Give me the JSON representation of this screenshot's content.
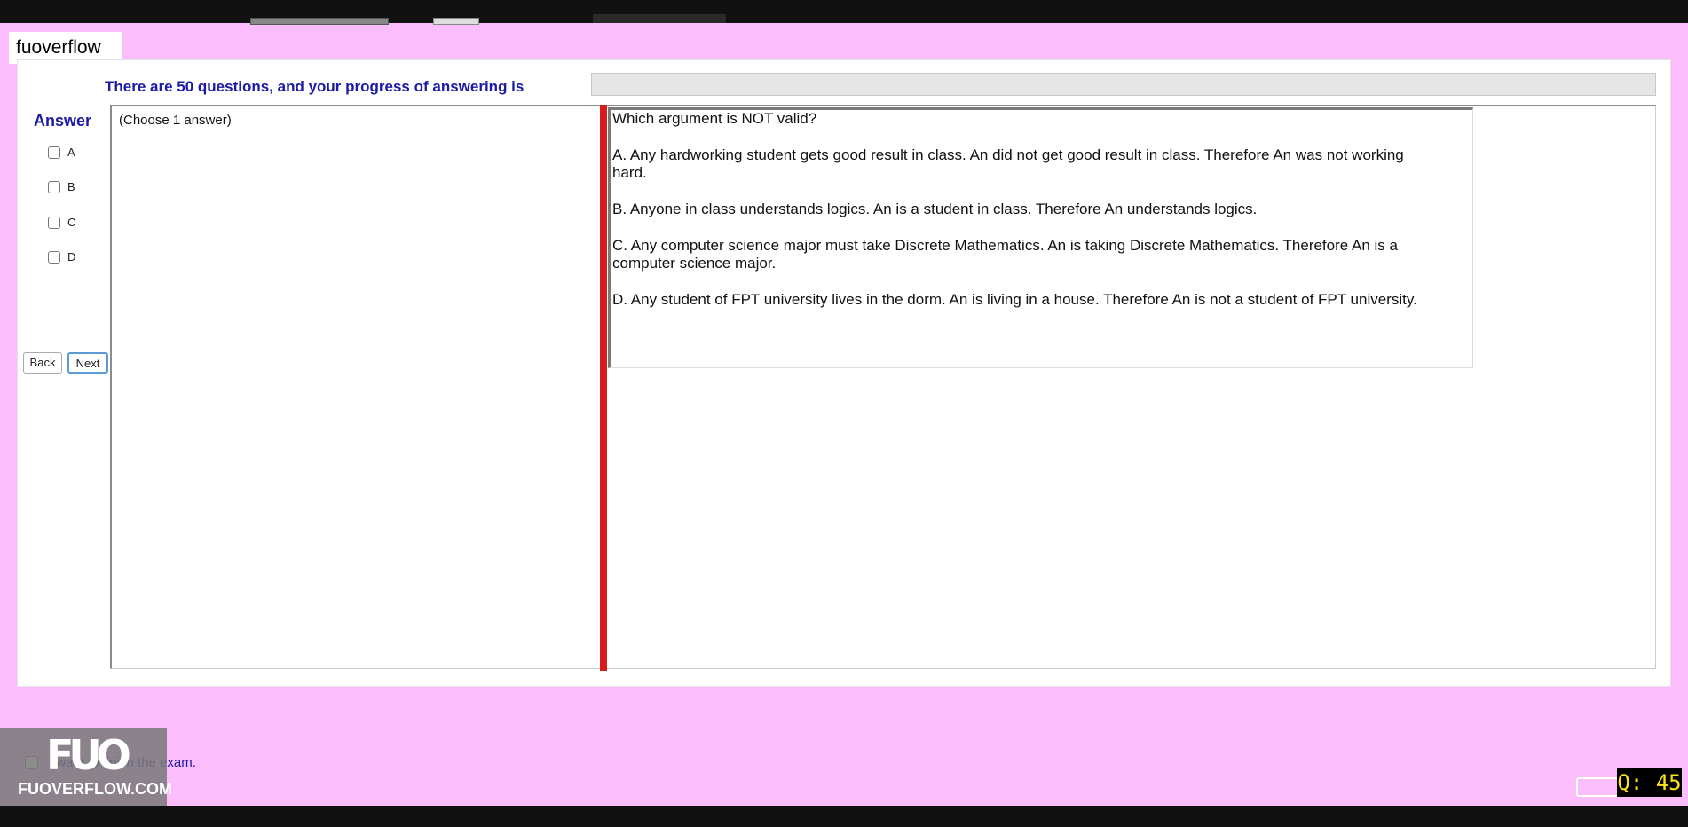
{
  "watermark": {
    "tag": "fuoverflow",
    "logo_text": "FUOVERFLOW.COM"
  },
  "progress": {
    "label": "There are 50 questions, and your progress of answering is"
  },
  "answer": {
    "label": "Answer",
    "options": [
      "A",
      "B",
      "C",
      "D"
    ],
    "back_label": "Back",
    "next_label": "Next",
    "choose_hint": "(Choose 1 answer)"
  },
  "question": {
    "prompt": "Which argument is NOT valid?",
    "choices": [
      "A.  Any hardworking student gets good result in class. An did not get good result in class. Therefore An was not working hard.",
      "B.  Anyone in class understands logics. An is a student in class. Therefore An understands logics.",
      "C.  Any computer science major must take Discrete Mathematics. An is taking Discrete Mathematics. Therefore An is a computer science major.",
      "D.  Any student of FPT university lives in the dorm. An is living in a house. Therefore An is not a student of FPT university."
    ]
  },
  "finish": {
    "label": "I want to finish the exam."
  },
  "badge": {
    "label": "Q: 45"
  },
  "colors": {
    "background": "#fbbdfb",
    "accent_text": "#1b1ba6",
    "divider": "#d81b1b",
    "badge_text": "#f7e31a"
  }
}
